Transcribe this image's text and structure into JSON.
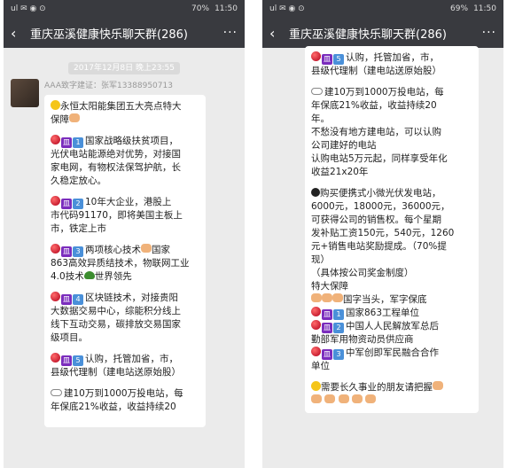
{
  "status_left": "ul ✉ ◉ ⊙",
  "left_screen": {
    "battery": "70%",
    "time": "11:50",
    "title": "重庆巫溪健康快乐聊天群(286)",
    "more": "···",
    "timestamp": "2017年12月8日 晚上23:55",
    "sender": "AAA致字建证：张军13388950713",
    "lines": {
      "l1": "永恒太阳能集团五大亮点特大",
      "l2": "保障",
      "p1a": "国家战略级扶贫项目，",
      "p1b": "光伏电站能源绝对优势，对接国",
      "p1c": "家电网，有物权法保驾护航，长",
      "p1d": "久稳定放心。",
      "p2a": "10年大企业，港股上",
      "p2b": "市代码91170，即将美国主板上",
      "p2c": "市，铁定上市",
      "p3a": "两项核心技术",
      "p3b": "国家",
      "p3c": "863高效异质结技术，物联网工业",
      "p3d": "4.0技术",
      "p3e": "世界领先",
      "p4a": "区块链技术，对接贵阳",
      "p4b": "大数据交易中心，综能积分线上",
      "p4c": "线下互动交易，碳排放交易国家",
      "p4d": "级项目。",
      "p5a": "认购，托管加省，市，",
      "p5b": "县级代理制（建电站送原始股）",
      "p6a": "建10万到1000万投电站，每",
      "p6b": "年保底21%收益，收益持续20"
    }
  },
  "right_screen": {
    "battery": "69%",
    "time": "11:50",
    "title": "重庆巫溪健康快乐聊天群(286)",
    "more": "···",
    "lines": {
      "r1a": "认购，托管加省，市，",
      "r1b": "县级代理制（建电站送原始股）",
      "r2a": "建10万到1000万投电站，每",
      "r2b": "年保底21%收益，收益持续20",
      "r2c": "年。",
      "r2d": "不愁没有地方建电站，可以认购",
      "r2e": "公司建好的电站",
      "r2f": "认购电站5万元起，同样享受年化",
      "r2g": "收益21x20年",
      "r3a": "购买便携式小微光伏发电站，",
      "r3b": "6000元，18000元，36000元，",
      "r3c": "可获得公司的销售权。每个星期",
      "r3d": "发补贴工资150元，540元，1260",
      "r3e": "元+销售电站奖励提成。（70%提",
      "r3f": "现）",
      "r3g": "（具体按公司奖金制度）",
      "r3h": "特大保障",
      "r3i": "国字当头，军字保底",
      "r4a": "国家863工程单位",
      "r4b": "中国人人民解放军总后",
      "r4c": "勤部军用物资动员供应商",
      "r4d": "中军创即军民融合合作",
      "r4e": "单位",
      "r5a": "需要长久事业的朋友请把握"
    }
  },
  "badge_numbers": [
    "1",
    "2",
    "3",
    "4",
    "5"
  ],
  "box_m_text": "皿",
  "icons": [
    "cherry-icon",
    "smile-icon",
    "hand-icon",
    "cloud-icon",
    "bomb-icon",
    "turtle-icon",
    "globe-icon",
    "back-arrow-icon"
  ],
  "colors": {
    "titlebar": "#393a3f",
    "chat_bg": "#ebebeb",
    "bubble": "#ffffff"
  }
}
